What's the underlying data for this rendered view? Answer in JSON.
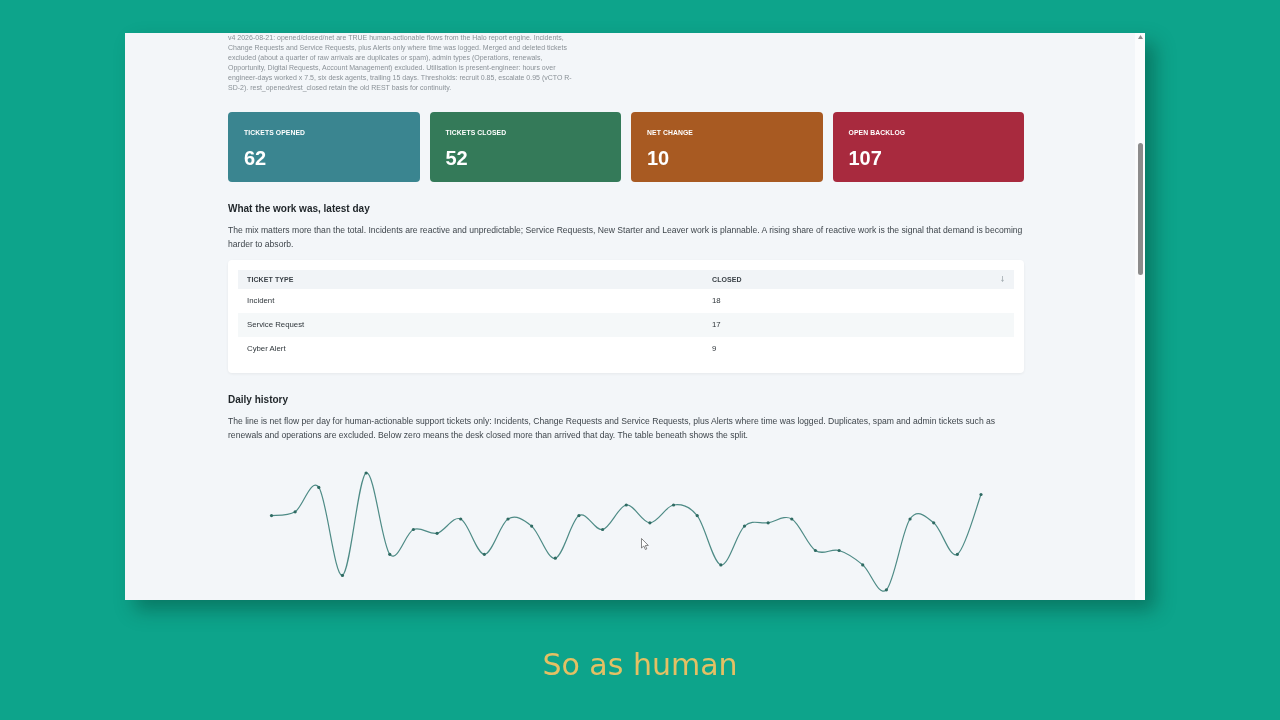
{
  "notes": "v4 2026-08-21: opened/closed/net are TRUE human-actionable flows from the Halo report engine. Incidents, Change Requests and Service Requests, plus Alerts only where time was logged. Merged and deleted tickets excluded (about a quarter of raw arrivals are duplicates or spam), admin types (Operations, renewals, Opportunity, Digital Requests, Account Management) excluded. Utilisation is present-engineer: hours over engineer-days worked x 7.5, six desk agents, trailing 15 days. Thresholds: recruit 0.85, escalate 0.95 (vCTO R-SD-2). rest_opened/rest_closed retain the old REST basis for continuity.",
  "stat_cards": [
    {
      "label": "TICKETS OPENED",
      "value": "62",
      "color": "#3a8590"
    },
    {
      "label": "TICKETS CLOSED",
      "value": "52",
      "color": "#347a59"
    },
    {
      "label": "NET CHANGE",
      "value": "10",
      "color": "#a85a22"
    },
    {
      "label": "OPEN BACKLOG",
      "value": "107",
      "color": "#a82a3e"
    }
  ],
  "work_mix": {
    "heading": "What the work was, latest day",
    "description": "The mix matters more than the total. Incidents are reactive and unpredictable; Service Requests, New Starter and Leaver work is plannable. A rising share of reactive work is the signal that demand is becoming harder to absorb.",
    "table": {
      "columns": [
        "TICKET TYPE",
        "CLOSED"
      ],
      "rows": [
        [
          "Incident",
          "18"
        ],
        [
          "Service Request",
          "17"
        ],
        [
          "Cyber Alert",
          "9"
        ]
      ]
    }
  },
  "daily_history": {
    "heading": "Daily history",
    "description": "The line is net flow per day for human-actionable support tickets only: Incidents, Change Requests and Service Requests, plus Alerts where time was logged. Duplicates, spam and admin tickets such as renewals and operations are excluded. Below zero means the desk closed more than arrived that day. The table beneath shows the split."
  },
  "caption": "So as human"
}
